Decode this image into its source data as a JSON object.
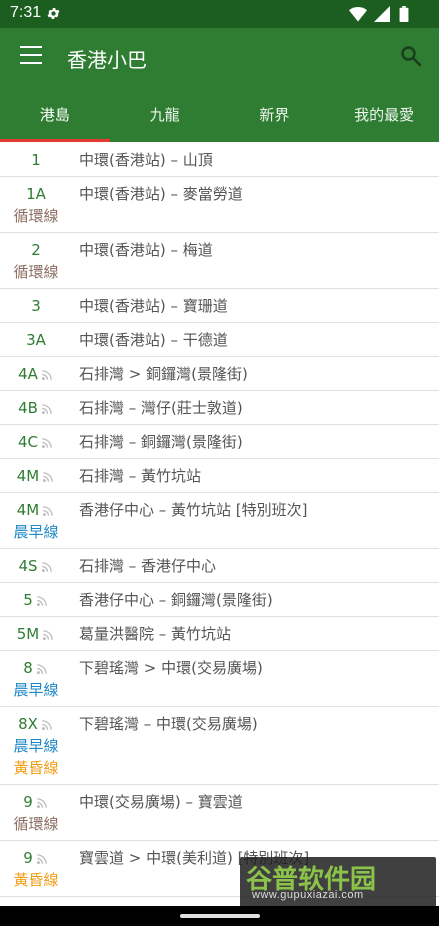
{
  "status_bar": {
    "time": "7:31",
    "colors": {
      "background": "#1b5e20"
    }
  },
  "app_bar": {
    "title": "香港小巴",
    "menu_icon": "menu-icon",
    "search_icon": "search-icon",
    "colors": {
      "primary": "#2e7d32",
      "tab_indicator": "#e53935"
    }
  },
  "tabs": [
    {
      "label": "港島",
      "selected": true
    },
    {
      "label": "九龍",
      "selected": false
    },
    {
      "label": "新界",
      "selected": false
    },
    {
      "label": "我的最愛",
      "selected": false
    }
  ],
  "badge_colors": {
    "circular": "#8d6e63",
    "morning": "#1e88c8",
    "evening": "#f39c12"
  },
  "routes": [
    {
      "number": "1",
      "rss": false,
      "badges": [],
      "description": "中環(香港站) – 山頂"
    },
    {
      "number": "1A",
      "rss": false,
      "badges": [
        {
          "text": "循環線",
          "type": "circular"
        }
      ],
      "description": "中環(香港站) – 麥當勞道"
    },
    {
      "number": "2",
      "rss": false,
      "badges": [
        {
          "text": "循環線",
          "type": "circular"
        }
      ],
      "description": "中環(香港站) – 梅道"
    },
    {
      "number": "3",
      "rss": false,
      "badges": [],
      "description": "中環(香港站) – 寶珊道"
    },
    {
      "number": "3A",
      "rss": false,
      "badges": [],
      "description": "中環(香港站) – 干德道"
    },
    {
      "number": "4A",
      "rss": true,
      "badges": [],
      "description": "石排灣 > 銅鑼灣(景隆街)"
    },
    {
      "number": "4B",
      "rss": true,
      "badges": [],
      "description": "石排灣 – 灣仔(莊士敦道)"
    },
    {
      "number": "4C",
      "rss": true,
      "badges": [],
      "description": "石排灣 – 銅鑼灣(景隆街)"
    },
    {
      "number": "4M",
      "rss": true,
      "badges": [],
      "description": "石排灣 – 黃竹坑站"
    },
    {
      "number": "4M",
      "rss": true,
      "badges": [
        {
          "text": "晨早線",
          "type": "morning"
        }
      ],
      "description": "香港仔中心 – 黃竹坑站 [特別班次]"
    },
    {
      "number": "4S",
      "rss": true,
      "badges": [],
      "description": "石排灣 – 香港仔中心"
    },
    {
      "number": "5",
      "rss": true,
      "badges": [],
      "description": "香港仔中心 – 銅鑼灣(景隆街)"
    },
    {
      "number": "5M",
      "rss": true,
      "badges": [],
      "description": "葛量洪醫院 – 黃竹坑站"
    },
    {
      "number": "8",
      "rss": true,
      "badges": [
        {
          "text": "晨早線",
          "type": "morning"
        }
      ],
      "description": "下碧瑤灣 > 中環(交易廣場)"
    },
    {
      "number": "8X",
      "rss": true,
      "badges": [
        {
          "text": "晨早線",
          "type": "morning"
        },
        {
          "text": "黃昏線",
          "type": "evening"
        }
      ],
      "description": "下碧瑤灣 – 中環(交易廣場)"
    },
    {
      "number": "9",
      "rss": true,
      "badges": [
        {
          "text": "循環線",
          "type": "circular"
        }
      ],
      "description": "中環(交易廣場) – 寶雲道"
    },
    {
      "number": "9",
      "rss": true,
      "badges": [
        {
          "text": "黃昏線",
          "type": "evening"
        }
      ],
      "description": "寶雲道 > 中環(美利道) [特別班次]"
    }
  ],
  "watermark": {
    "title": "谷普软件园",
    "url": "www.gupuxiazai.com"
  }
}
